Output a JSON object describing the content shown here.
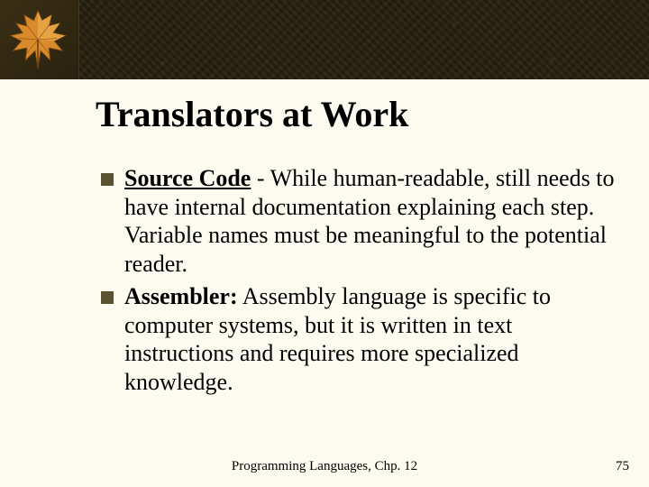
{
  "slide": {
    "title": "Translators at Work",
    "bullets": [
      {
        "term": "Source Code",
        "term_style": "underline",
        "separator": "  - ",
        "body": "While human-readable, still needs to have internal documentation explaining each step.  Variable names must be meaningful to the potential reader."
      },
      {
        "term": "Assembler:",
        "term_style": "bold",
        "separator": "  ",
        "body": "Assembly language is specific to computer systems, but it is written in text instructions and requires more specialized knowledge."
      }
    ],
    "footer_center": "Programming Languages, Chp. 12",
    "page_number": "75"
  },
  "decor": {
    "leaf_icon": "maple-leaf-icon"
  }
}
